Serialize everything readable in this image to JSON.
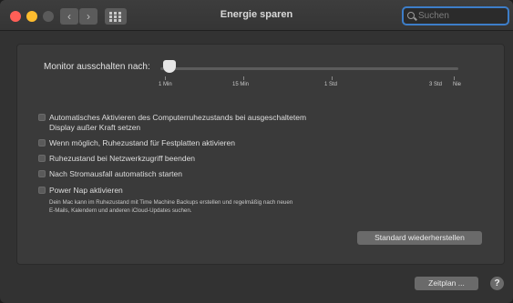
{
  "window": {
    "title": "Energie sparen"
  },
  "toolbar": {
    "back_icon": "chevron-left-icon",
    "forward_icon": "chevron-right-icon",
    "grid_icon": "grid-icon",
    "search": {
      "placeholder": "Suchen",
      "value": ""
    }
  },
  "colors": {
    "accent": "#3d7ec9",
    "close": "#ff5f57",
    "minimize": "#febc2e"
  },
  "monitor_off": {
    "label": "Monitor ausschalten nach:",
    "value_fraction": 0.03,
    "ticks": [
      "1 Min",
      "15 Min",
      "1 Std",
      "3 Std"
    ],
    "end_label": "Nie"
  },
  "options": [
    {
      "label": "Automatisches Aktivieren des Computerruhezustands bei ausgeschaltetem",
      "label2": "Display außer Kraft setzen",
      "checked": false
    },
    {
      "label": "Wenn möglich, Ruhezustand für Festplatten aktivieren",
      "checked": false
    },
    {
      "label": "Ruhezustand bei Netzwerkzugriff beenden",
      "checked": false
    },
    {
      "label": "Nach Stromausfall automatisch starten",
      "checked": false
    },
    {
      "label": "Power Nap aktivieren",
      "checked": false
    }
  ],
  "power_nap_description": {
    "line1": "Dein Mac kann im Ruhezustand mit Time Machine Backups erstellen und regelmäßig nach neuen",
    "line2": "E-Mails, Kalendern und anderen iCloud-Updates suchen."
  },
  "buttons": {
    "restore": "Standard wiederherstellen",
    "schedule": "Zeitplan ...",
    "help": "?"
  }
}
